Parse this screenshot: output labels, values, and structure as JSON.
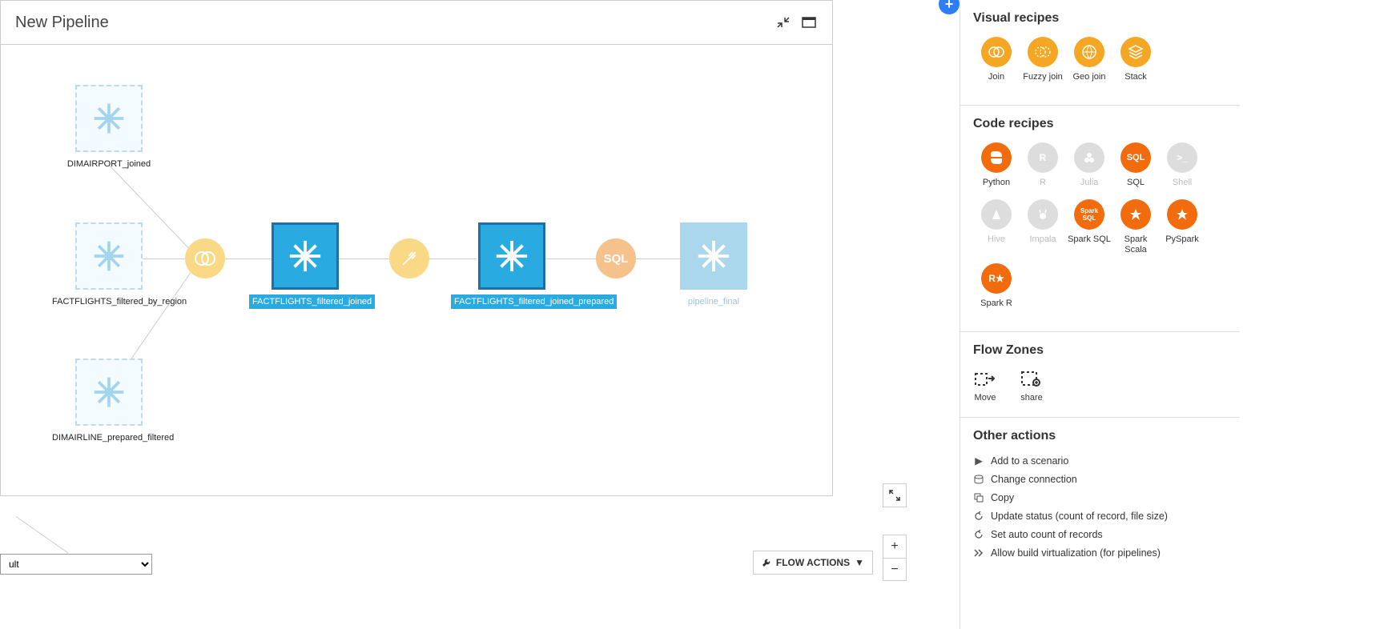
{
  "pipeline": {
    "title": "New Pipeline"
  },
  "nodes": {
    "n1": "DIMAIRPORT_joined",
    "n2": "FACTFLIGHTS_filtered_by_region",
    "n3": "DIMAIRLINE_prepared_filtered",
    "n4": "FACTFLIGHTS_filtered_joined",
    "n5": "FACTFLIGHTS_filtered_joined_prepared",
    "n6": "pipeline_final",
    "sql": "SQL"
  },
  "controls": {
    "flow_actions": "FLOW ACTIONS",
    "select_default": "ult"
  },
  "sidebar": {
    "visual_recipes": {
      "title": "Visual recipes",
      "items": [
        "Join",
        "Fuzzy join",
        "Geo join",
        "Stack"
      ]
    },
    "code_recipes": {
      "title": "Code recipes",
      "row1": [
        "Python",
        "R",
        "Julia",
        "SQL",
        "Shell"
      ],
      "row2": [
        "Hive",
        "Impala",
        "Spark SQL",
        "Spark Scala",
        "PySpark",
        "Spark R"
      ]
    },
    "flow_zones": {
      "title": "Flow Zones",
      "items": [
        "Move",
        "share"
      ]
    },
    "other_actions": {
      "title": "Other actions",
      "items": [
        "Add to a scenario",
        "Change connection",
        "Copy",
        "Update status (count of record, file size)",
        "Set auto count of records",
        "Allow build virtualization (for pipelines)"
      ]
    }
  }
}
